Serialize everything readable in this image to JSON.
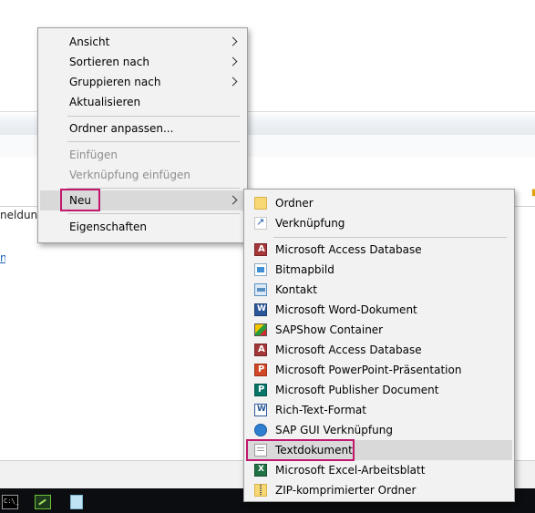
{
  "background": {
    "partial_column_text": "neldung",
    "partial_link_text": "n"
  },
  "context_menu": {
    "items": [
      {
        "label": "Ansicht"
      },
      {
        "label": "Sortieren nach"
      },
      {
        "label": "Gruppieren nach"
      },
      {
        "label": "Aktualisieren"
      },
      {
        "label": "Ordner anpassen..."
      },
      {
        "label": "Einfügen"
      },
      {
        "label": "Verknüpfung einfügen"
      },
      {
        "label": "Neu"
      },
      {
        "label": "Eigenschaften"
      }
    ]
  },
  "new_submenu": {
    "items": [
      {
        "label": "Ordner",
        "icon": "folder-icon"
      },
      {
        "label": "Verknüpfung",
        "icon": "shortcut-icon"
      },
      {
        "label": "Microsoft Access Database",
        "icon": "access-icon"
      },
      {
        "label": "Bitmapbild",
        "icon": "bitmap-icon"
      },
      {
        "label": "Kontakt",
        "icon": "contact-icon"
      },
      {
        "label": "Microsoft Word-Dokument",
        "icon": "word-icon"
      },
      {
        "label": "SAPShow Container",
        "icon": "sapshow-icon"
      },
      {
        "label": "Microsoft Access Database",
        "icon": "access-icon"
      },
      {
        "label": "Microsoft PowerPoint-Präsentation",
        "icon": "powerpoint-icon"
      },
      {
        "label": "Microsoft Publisher Document",
        "icon": "publisher-icon"
      },
      {
        "label": "Rich-Text-Format",
        "icon": "rtf-icon"
      },
      {
        "label": "SAP GUI Verknüpfung",
        "icon": "sap-gui-icon"
      },
      {
        "label": "Textdokument",
        "icon": "text-document-icon"
      },
      {
        "label": "Microsoft Excel-Arbeitsblatt",
        "icon": "excel-icon"
      },
      {
        "label": "ZIP-komprimierter Ordner",
        "icon": "zip-folder-icon"
      }
    ]
  },
  "taskbar": {
    "cmd_icon_text": "C:\\_"
  },
  "colors": {
    "highlight_border": "#c2176e",
    "menu_background": "#f2f2f2",
    "hover_background": "#d9d9d9",
    "taskbar": "#0c0d10"
  }
}
